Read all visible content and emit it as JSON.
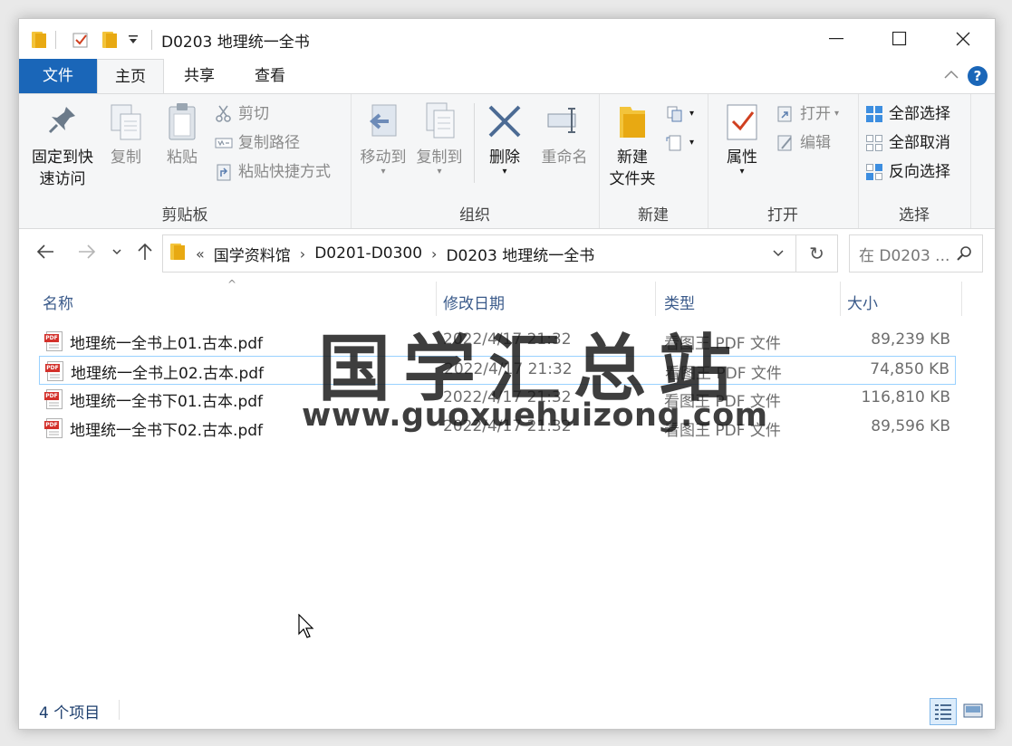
{
  "window": {
    "title": "D0203 地理统一全书"
  },
  "ribbon": {
    "tabs": [
      {
        "label": "文件"
      },
      {
        "label": "主页"
      },
      {
        "label": "共享"
      },
      {
        "label": "查看"
      }
    ],
    "clipboard": {
      "pin_label_1": "固定到快",
      "pin_label_2": "速访问",
      "copy_label": "复制",
      "paste_label": "粘贴",
      "cut_label": "剪切",
      "copy_path_label": "复制路径",
      "paste_shortcut_label": "粘贴快捷方式",
      "group_label": "剪贴板"
    },
    "organize": {
      "move_to_label": "移动到",
      "copy_to_label": "复制到",
      "delete_label": "删除",
      "rename_label": "重命名",
      "group_label": "组织"
    },
    "new": {
      "new_folder_label_1": "新建",
      "new_folder_label_2": "文件夹",
      "group_label": "新建"
    },
    "open": {
      "properties_label": "属性",
      "open_label": "打开",
      "edit_label": "编辑",
      "group_label": "打开"
    },
    "select": {
      "select_all_label": "全部选择",
      "select_none_label": "全部取消",
      "invert_label": "反向选择",
      "group_label": "选择"
    }
  },
  "address": {
    "overflow": "«",
    "crumbs": [
      "国学资料馆",
      "D0201-D0300",
      "D0203 地理统一全书"
    ],
    "search_placeholder": "在 D0203 ..."
  },
  "columns": {
    "name": "名称",
    "date": "修改日期",
    "type": "类型",
    "size": "大小"
  },
  "files": [
    {
      "name": "地理统一全书上01.古本.pdf",
      "date": "2022/4/17 21:32",
      "type": "看图王 PDF 文件",
      "size": "89,239 KB"
    },
    {
      "name": "地理统一全书上02.古本.pdf",
      "date": "2022/4/17 21:32",
      "type": "看图王 PDF 文件",
      "size": "74,850 KB"
    },
    {
      "name": "地理统一全书下01.古本.pdf",
      "date": "2022/4/17 21:32",
      "type": "看图王 PDF 文件",
      "size": "116,810 KB"
    },
    {
      "name": "地理统一全书下02.古本.pdf",
      "date": "2022/4/17 21:32",
      "type": "看图王 PDF 文件",
      "size": "89,596 KB"
    }
  ],
  "watermark": {
    "title": "国学汇总站",
    "url": "www.guoxuehuizong.com"
  },
  "status": {
    "item_count": "4 个项目"
  },
  "colors": {
    "accent": "#1a66b8",
    "selection_border": "#99d1ff",
    "pdf_red": "#d3312b",
    "folder_yellow": "#f3c43b"
  }
}
